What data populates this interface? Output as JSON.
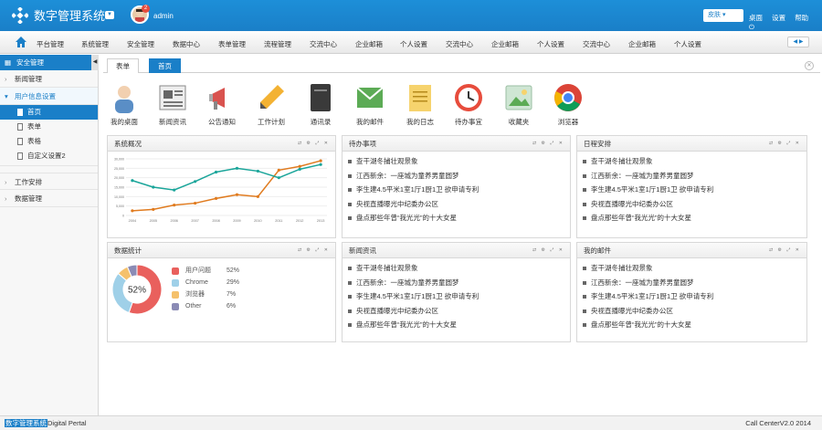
{
  "header": {
    "title": "数字管理系统",
    "username": "admin",
    "notification_count": "2",
    "skin_label": "皮肤",
    "links": [
      "桌面",
      "设置",
      "帮助"
    ]
  },
  "nav": {
    "items": [
      "平台管理",
      "系统管理",
      "安全管理",
      "数据中心",
      "表单管理",
      "流程管理",
      "交流中心",
      "企业邮箱",
      "个人设置",
      "交流中心",
      "企业邮箱",
      "个人设置",
      "交流中心",
      "企业邮箱",
      "个人设置"
    ]
  },
  "sidebar": {
    "title": "安全管理",
    "items": [
      {
        "label": "新闻管理"
      },
      {
        "label": "用户信息设置"
      },
      {
        "label": "工作安排"
      },
      {
        "label": "数据管理"
      }
    ],
    "subitems": [
      "首页",
      "表单",
      "表格",
      "自定义设置2"
    ]
  },
  "tabs": [
    "表单",
    "首页"
  ],
  "quick": [
    "我的桌面",
    "新闻资讯",
    "公告通知",
    "工作计划",
    "通讯录",
    "我的邮件",
    "我的日志",
    "待办事宜",
    "收藏夹",
    "浏览器"
  ],
  "panels": {
    "system": {
      "title": "系统概况"
    },
    "todo": {
      "title": "待办事项"
    },
    "schedule": {
      "title": "日程安排"
    },
    "stats": {
      "title": "数据统计"
    },
    "news": {
      "title": "新闻资讯"
    },
    "mail": {
      "title": "我的邮件"
    }
  },
  "list_items": [
    "查干湖冬捕壮观景象",
    "江西新余：一座城为童养男童圆梦",
    "李生建4.5平米1室1厅1厨1卫 欲申请专利",
    "央视直播曝光中纪委办公区",
    "盘点那些年曾“我光光”的十大女星"
  ],
  "footer": {
    "left_highlight": "数字管理系统",
    "left_rest": "Digital Pertal",
    "right": "Call CenterV2.0 2014"
  },
  "chart_data": [
    {
      "type": "line",
      "categories": [
        "2004",
        "2005",
        "2006",
        "2007",
        "2008",
        "2009",
        "2010",
        "2011",
        "2012",
        "2013"
      ],
      "yticks": [
        "0",
        "5,000",
        "10,000",
        "15,000",
        "20,000",
        "25,000",
        "30,000"
      ],
      "ylim": [
        0,
        30000
      ],
      "series": [
        {
          "color": "#e07b1f",
          "values": [
            2500,
            3200,
            5500,
            6500,
            9000,
            11000,
            10000,
            24000,
            26000,
            29000
          ]
        },
        {
          "color": "#1aa59a",
          "values": [
            18500,
            15000,
            13500,
            18000,
            23000,
            25000,
            23500,
            20000,
            24500,
            27000
          ]
        }
      ]
    },
    {
      "type": "pie",
      "center_label": "52%",
      "labels": [
        "用户问题",
        "Chrome",
        "浏览器",
        "Other"
      ],
      "values": [
        "52%",
        "29%",
        "7%",
        "6%"
      ],
      "colors": [
        "#e9605d",
        "#9fd0e8",
        "#f5c16c",
        "#8b8bb5"
      ]
    }
  ]
}
